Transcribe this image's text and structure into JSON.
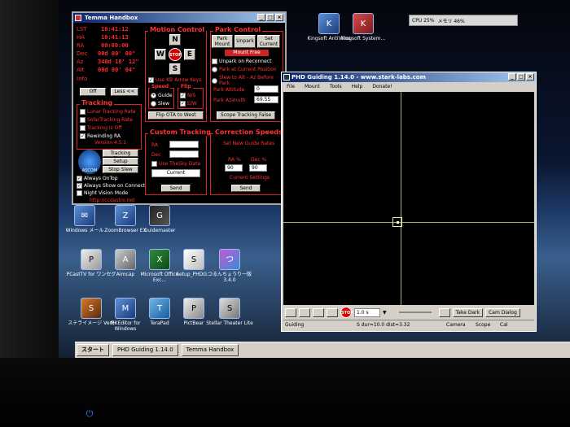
{
  "tray": {
    "cpu": "CPU 25%",
    "mem": "メモリ 46%"
  },
  "temma": {
    "title": "Temma Handbox",
    "coords": [
      {
        "label": "LST",
        "value": "10:41:12"
      },
      {
        "label": "HA",
        "value": "10:41:13"
      },
      {
        "label": "RA",
        "value": "00:00:00"
      },
      {
        "label": "Dec",
        "value": "00d 00' 00\""
      },
      {
        "label": "Az",
        "value": "340d 18' 12\""
      },
      {
        "label": "Alt",
        "value": "00d 00' 04\""
      },
      {
        "label": "Info",
        "value": ""
      }
    ],
    "off_button": "Off",
    "less_button": "Less <<",
    "tracking": {
      "title": "Tracking",
      "options": [
        {
          "label": "Lunar Tracking Rate",
          "checked": false
        },
        {
          "label": "SolarTracking Rate",
          "checked": false
        },
        {
          "label": "Tracking is Off",
          "checked": false
        },
        {
          "label": "Rewinding RA",
          "checked": true
        }
      ]
    },
    "version": "Version 4.5.1",
    "ascom_label": "ASCOM",
    "tracking_timer_button": "Tracking Timer",
    "setup_button": "Setup",
    "stop_slew_button": "Stop Slew",
    "bottom_checks": [
      {
        "label": "Always OnTop",
        "checked": true
      },
      {
        "label": "Always Show on Connect",
        "checked": true
      },
      {
        "label": "Night Vision Mode",
        "checked": false
      }
    ],
    "url": "http://ccdastro.net",
    "motion": {
      "title": "Motion Control",
      "north": "N",
      "south": "S",
      "east": "E",
      "west": "W",
      "stop": "STOP",
      "use_kb": "Use KB Arrow Keys",
      "speed_title": "Speed",
      "guide": "Guide",
      "slew": "Slew",
      "flip_title": "Flip",
      "ns": "N/S",
      "ew": "E/W",
      "flip_ota": "Flip OTA to West"
    },
    "park": {
      "title": "Park Control",
      "park_mount": "Park Mount",
      "unpark": "Unpark",
      "set_current": "Set Current",
      "status": "Mount Free",
      "unpark_reconnect": "Unpark on Reconnect",
      "park_current": "Park at Current Position",
      "slew_alt_az": "Slew to Alt - Az Before Park",
      "park_altitude_label": "Park Altitude",
      "park_altitude_value": "0",
      "park_azimuth_label": "Park Azimuth",
      "park_azimuth_value": "69.55",
      "scope_tracking_false": "Scope Tracking False"
    },
    "custom": {
      "title": "Custom Tracking",
      "ra": "RA",
      "dec": "Dec",
      "use_thesky": "Use TheSky Data",
      "current": "Current",
      "send": "Send"
    },
    "correction": {
      "title": "Correction Speeds",
      "set_new": "Set New Guide Rates",
      "ra_pct": "RA %",
      "dec_pct": "Dec %",
      "ra_val": "90",
      "dec_val": "90",
      "current_settings": "Current Settings",
      "send": "Send"
    }
  },
  "desktop_icons": [
    {
      "label": "Kingsoft AntiVirus",
      "glyph": "K"
    },
    {
      "label": "Kingsoft System...",
      "glyph": "K"
    },
    {
      "label": "Windows メール",
      "glyph": "✉"
    },
    {
      "label": "ZoomBrowser EX",
      "glyph": "Z"
    },
    {
      "label": "Guidemaster",
      "glyph": "G"
    },
    {
      "label": "PCastTV for ワンセグ",
      "glyph": "P"
    },
    {
      "label": "Aimcap",
      "glyph": "A"
    },
    {
      "label": "Microsoft Office Exc...",
      "glyph": "X"
    },
    {
      "label": "Setup_PHDG...",
      "glyph": "S"
    },
    {
      "label": "つるんちょうり一版 3.4.0",
      "glyph": "つ"
    },
    {
      "label": "ステライメージ Ver5",
      "glyph": "S"
    },
    {
      "label": "MKEditor for Windows",
      "glyph": "M"
    },
    {
      "label": "TeraPad",
      "glyph": "T"
    },
    {
      "label": "PictBear",
      "glyph": "P"
    },
    {
      "label": "Stellar Theater Lite",
      "glyph": "S"
    }
  ],
  "phd": {
    "title": "PHD Guiding 1.14.0  -  www.stark-labs.com",
    "menu": [
      "File",
      "Mount",
      "Tools",
      "Help",
      "Donate!"
    ],
    "exposure": "1.0 s",
    "take_dark": "Take Dark",
    "cam_dialog": "Cam Dialog",
    "status_left": "Guiding",
    "status_mid": "S dur=10.0 dist=3.32",
    "status_camera": "Camera",
    "status_scope": "Scope",
    "status_cal": "Cal"
  },
  "taskbar": {
    "start": "スタート",
    "items": [
      "PHD Guiding 1.14.0",
      "Temma Handbox"
    ]
  }
}
